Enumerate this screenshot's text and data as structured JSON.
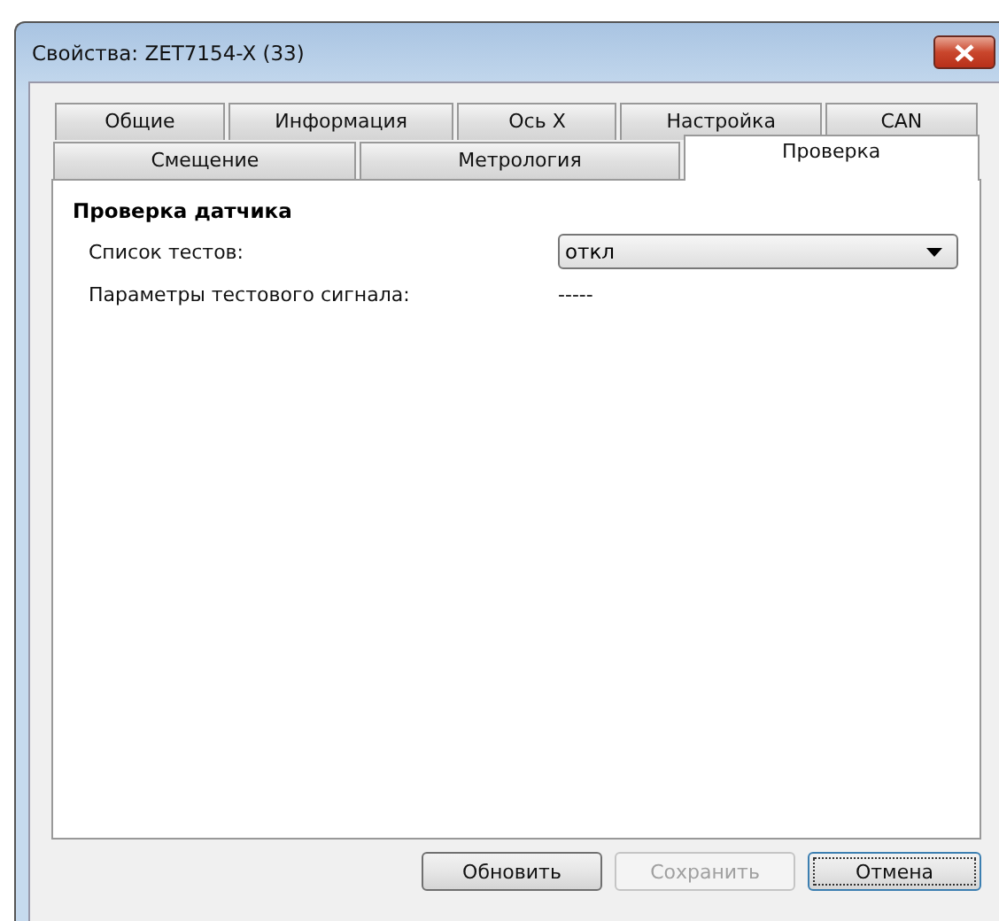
{
  "window": {
    "title": "Свойства: ZET7154-X (33)"
  },
  "tab_rows": [
    [
      {
        "label": "Общие",
        "selected": false
      },
      {
        "label": "Информация",
        "selected": false
      },
      {
        "label": "Ось X",
        "selected": false
      },
      {
        "label": "Настройка",
        "selected": false
      },
      {
        "label": "CAN",
        "selected": false
      }
    ],
    [
      {
        "label": "Смещение",
        "selected": false
      },
      {
        "label": "Метрология",
        "selected": false
      },
      {
        "label": "Проверка",
        "selected": true
      }
    ]
  ],
  "section": {
    "title": "Проверка датчика",
    "fields": [
      {
        "kind": "dropdown",
        "label": "Список тестов:",
        "value": "откл"
      },
      {
        "kind": "text",
        "label": "Параметры тестового сигнала:",
        "value": "-----"
      }
    ]
  },
  "buttons": [
    {
      "label": "Обновить",
      "disabled": false,
      "focused": false
    },
    {
      "label": "Сохранить",
      "disabled": true,
      "focused": false
    },
    {
      "label": "Отмена",
      "disabled": false,
      "focused": true
    }
  ]
}
